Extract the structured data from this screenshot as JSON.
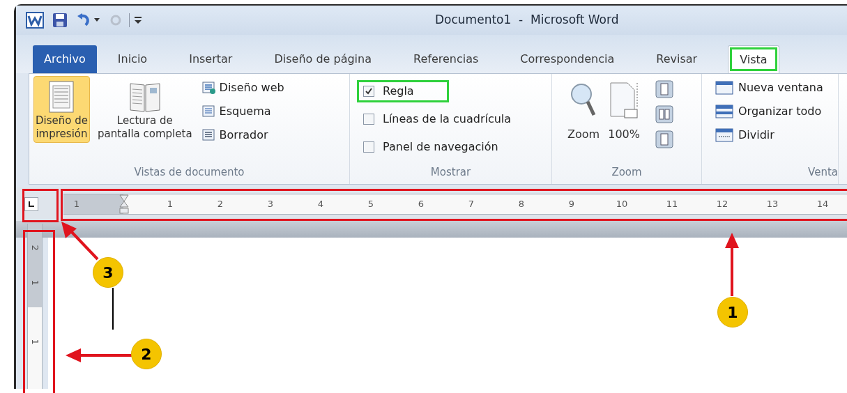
{
  "window": {
    "title": "Documento1  -  Microsoft Word"
  },
  "tabs": [
    {
      "label": "Archivo",
      "kind": "file",
      "selected": false,
      "highlighted": false
    },
    {
      "label": "Inicio",
      "kind": "tab",
      "selected": false,
      "highlighted": false
    },
    {
      "label": "Insertar",
      "kind": "tab",
      "selected": false,
      "highlighted": false
    },
    {
      "label": "Diseño de página",
      "kind": "tab",
      "selected": false,
      "highlighted": false
    },
    {
      "label": "Referencias",
      "kind": "tab",
      "selected": false,
      "highlighted": false
    },
    {
      "label": "Correspondencia",
      "kind": "tab",
      "selected": false,
      "highlighted": false
    },
    {
      "label": "Revisar",
      "kind": "tab",
      "selected": false,
      "highlighted": false
    },
    {
      "label": "Vista",
      "kind": "tab",
      "selected": true,
      "highlighted": true
    }
  ],
  "ribbon": {
    "groups": [
      {
        "kind": "views",
        "label": "Vistas de documento",
        "large": [
          {
            "lines": [
              "Diseño de",
              "impresión"
            ],
            "selected": true
          },
          {
            "lines": [
              "Lectura de",
              "pantalla completa"
            ],
            "selected": false
          }
        ],
        "items": [
          "Diseño web",
          "Esquema",
          "Borrador"
        ]
      },
      {
        "kind": "show",
        "label": "Mostrar",
        "checkboxes": [
          {
            "label": "Regla",
            "checked": true,
            "highlighted": true
          },
          {
            "label": "Líneas de la cuadrícula",
            "checked": false,
            "highlighted": false
          },
          {
            "label": "Panel de navegación",
            "checked": false,
            "highlighted": false
          }
        ]
      },
      {
        "kind": "zoom",
        "label": "Zoom",
        "large": [
          {
            "lines": [
              "Zoom"
            ]
          },
          {
            "lines": [
              "100%"
            ]
          }
        ]
      },
      {
        "kind": "window",
        "label": "Venta",
        "items": [
          "Nueva ventana",
          "Organizar todo",
          "Dividir"
        ]
      }
    ]
  },
  "ruler": {
    "horizontal": [
      "1",
      "1",
      "2",
      "3",
      "4",
      "5",
      "6",
      "7",
      "8",
      "9",
      "10",
      "11",
      "12",
      "13",
      "14"
    ],
    "vertical": [
      "2",
      "1",
      "1"
    ]
  },
  "callouts": [
    "1",
    "2",
    "3"
  ]
}
